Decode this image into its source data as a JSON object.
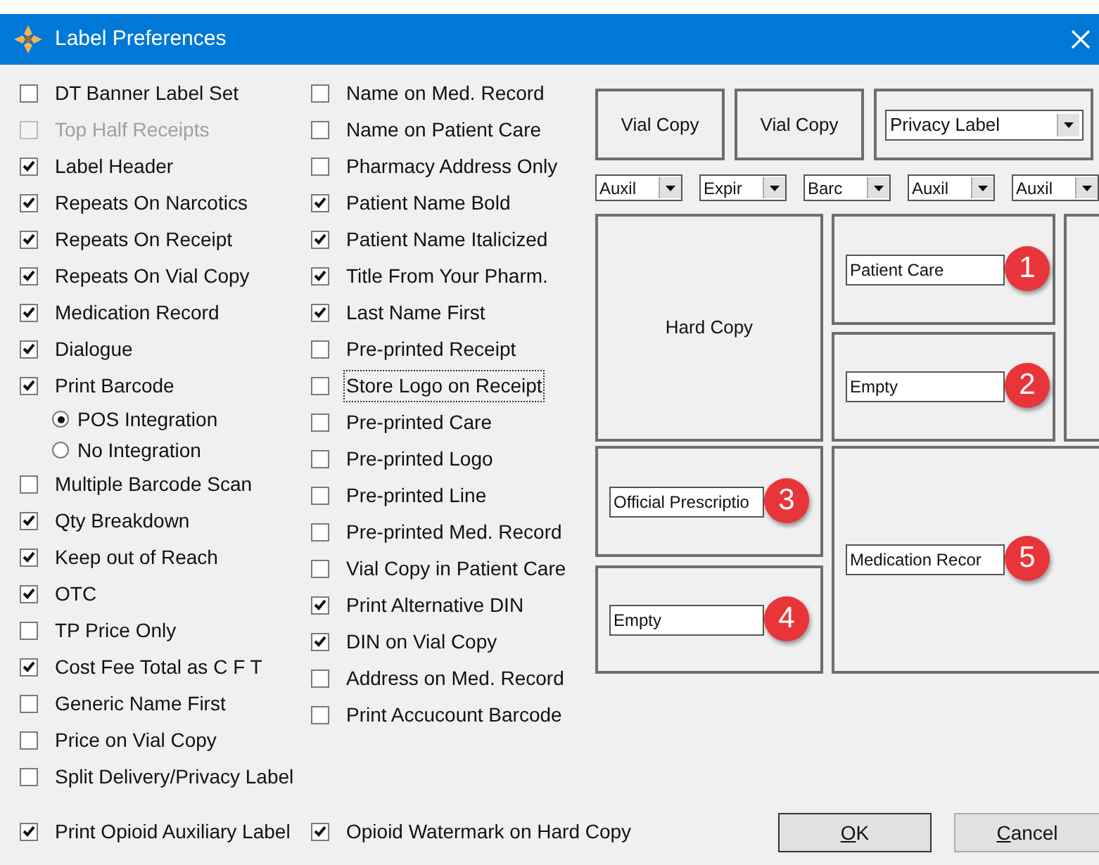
{
  "window": {
    "title": "Label Preferences"
  },
  "column_1": [
    {
      "kind": "checkbox",
      "label": "DT Banner Label Set",
      "checked": false,
      "disabled": false
    },
    {
      "kind": "checkbox",
      "label": "Top Half Receipts",
      "checked": false,
      "disabled": true
    },
    {
      "kind": "checkbox",
      "label": "Label Header",
      "checked": true,
      "disabled": false
    },
    {
      "kind": "checkbox",
      "label": "Repeats On Narcotics",
      "checked": true,
      "disabled": false
    },
    {
      "kind": "checkbox",
      "label": "Repeats On Receipt",
      "checked": true,
      "disabled": false
    },
    {
      "kind": "checkbox",
      "label": "Repeats On Vial Copy",
      "checked": true,
      "disabled": false
    },
    {
      "kind": "checkbox",
      "label": "Medication Record",
      "checked": true,
      "disabled": false
    },
    {
      "kind": "checkbox",
      "label": "Dialogue",
      "checked": true,
      "disabled": false
    },
    {
      "kind": "checkbox",
      "label": "Print Barcode",
      "checked": true,
      "disabled": false
    },
    {
      "kind": "radio",
      "label": "POS Integration",
      "selected": true
    },
    {
      "kind": "radio",
      "label": "No Integration",
      "selected": false
    },
    {
      "kind": "checkbox",
      "label": "Multiple Barcode Scan",
      "checked": false,
      "disabled": false
    },
    {
      "kind": "checkbox",
      "label": "Qty Breakdown",
      "checked": true,
      "disabled": false
    },
    {
      "kind": "checkbox",
      "label": "Keep out of Reach",
      "checked": true,
      "disabled": false
    },
    {
      "kind": "checkbox",
      "label": "OTC",
      "checked": true,
      "disabled": false
    },
    {
      "kind": "checkbox",
      "label": "TP Price Only",
      "checked": false,
      "disabled": false
    },
    {
      "kind": "checkbox",
      "label": "Cost Fee Total as C F T",
      "checked": true,
      "disabled": false
    },
    {
      "kind": "checkbox",
      "label": "Generic Name First",
      "checked": false,
      "disabled": false
    },
    {
      "kind": "checkbox",
      "label": "Price on Vial Copy",
      "checked": false,
      "disabled": false
    },
    {
      "kind": "checkbox",
      "label": "Split Delivery/Privacy Label",
      "checked": false,
      "disabled": false
    }
  ],
  "column_2": [
    {
      "label": "Name on Med. Record",
      "checked": false,
      "focused": false
    },
    {
      "label": "Name on Patient Care",
      "checked": false,
      "focused": false
    },
    {
      "label": "Pharmacy Address Only",
      "checked": false,
      "focused": false
    },
    {
      "label": "Patient Name Bold",
      "checked": true,
      "focused": false
    },
    {
      "label": "Patient Name Italicized",
      "checked": true,
      "focused": false
    },
    {
      "label": "Title From Your Pharm.",
      "checked": true,
      "focused": false
    },
    {
      "label": "Last Name First",
      "checked": true,
      "focused": false
    },
    {
      "label": "Pre-printed Receipt",
      "checked": false,
      "focused": false
    },
    {
      "label": "Store Logo on Receipt",
      "checked": false,
      "focused": true
    },
    {
      "label": "Pre-printed Care",
      "checked": false,
      "focused": false
    },
    {
      "label": "Pre-printed Logo",
      "checked": false,
      "focused": false
    },
    {
      "label": "Pre-printed Line",
      "checked": false,
      "focused": false
    },
    {
      "label": "Pre-printed Med. Record",
      "checked": false,
      "focused": false
    },
    {
      "label": "Vial Copy in Patient Care",
      "checked": false,
      "focused": false
    },
    {
      "label": "Print Alternative DIN",
      "checked": true,
      "focused": false
    },
    {
      "label": "DIN on Vial Copy",
      "checked": true,
      "focused": false
    },
    {
      "label": "Address on Med. Record",
      "checked": false,
      "focused": false
    },
    {
      "label": "Print Accucount Barcode",
      "checked": false,
      "focused": false
    }
  ],
  "bottom_row": [
    {
      "label": "Print Opioid Auxiliary Label",
      "checked": true
    },
    {
      "label": "Opioid Watermark on Hard Copy",
      "checked": true
    }
  ],
  "layout": {
    "top_boxes": [
      {
        "kind": "label",
        "text": "Vial Copy"
      },
      {
        "kind": "label",
        "text": "Vial Copy"
      },
      {
        "kind": "dropdown",
        "text": "Privacy Label"
      }
    ],
    "auxiliary_dropdowns": [
      "Auxil",
      "Expir",
      "Barc",
      "Auxil",
      "Auxil"
    ],
    "hard_copy": "Hard Copy",
    "slots": [
      {
        "value": "Patient Care",
        "marker": "1"
      },
      {
        "value": "Empty",
        "marker": "2"
      },
      {
        "value": "Official Prescriptio",
        "marker": "3"
      },
      {
        "value": "Empty",
        "marker": "4"
      },
      {
        "value": "Medication Recor",
        "marker": "5"
      }
    ]
  },
  "buttons": [
    "OK",
    "Cancel"
  ]
}
